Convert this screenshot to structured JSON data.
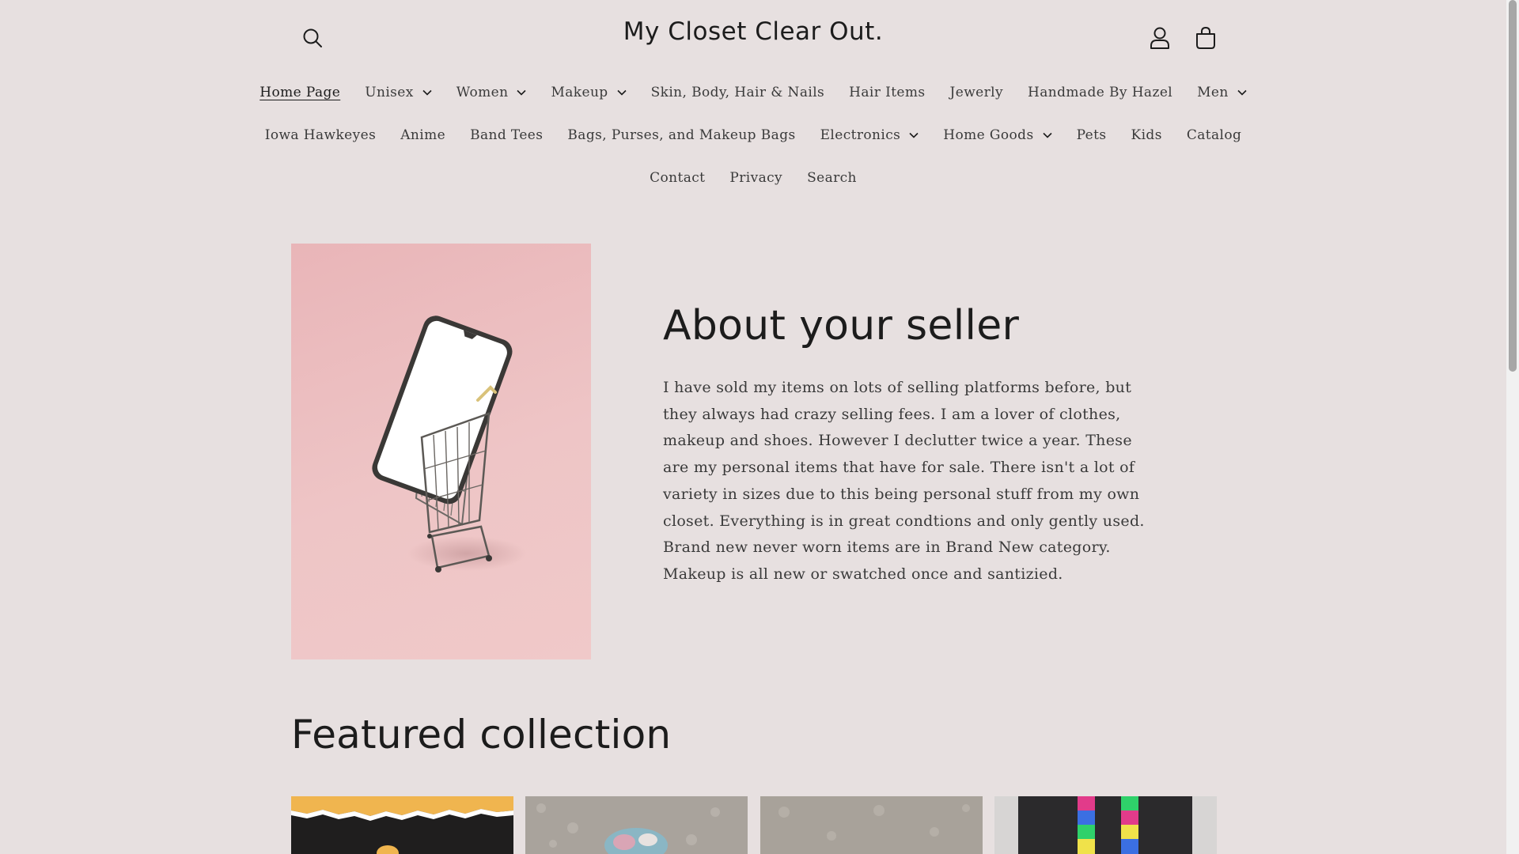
{
  "header": {
    "logo": "My Closet Clear Out.",
    "search_icon": "search-icon",
    "account_icon": "user-icon",
    "cart_icon": "cart-icon"
  },
  "nav": {
    "row1": [
      {
        "label": "Home Page",
        "active": true,
        "dropdown": false
      },
      {
        "label": "Unisex",
        "dropdown": true
      },
      {
        "label": "Women",
        "dropdown": true
      },
      {
        "label": "Makeup",
        "dropdown": true
      },
      {
        "label": "Skin, Body, Hair & Nails",
        "dropdown": false
      },
      {
        "label": "Hair Items",
        "dropdown": false
      },
      {
        "label": "Jewerly",
        "dropdown": false
      },
      {
        "label": "Handmade By Hazel",
        "dropdown": false
      },
      {
        "label": "Men",
        "dropdown": true
      }
    ],
    "row2": [
      {
        "label": "Iowa Hawkeyes",
        "dropdown": false
      },
      {
        "label": "Anime",
        "dropdown": false
      },
      {
        "label": "Band Tees",
        "dropdown": false
      },
      {
        "label": "Bags, Purses, and Makeup Bags",
        "dropdown": false
      },
      {
        "label": "Electronics",
        "dropdown": true
      },
      {
        "label": "Home Goods",
        "dropdown": true
      },
      {
        "label": "Pets",
        "dropdown": false
      },
      {
        "label": "Kids",
        "dropdown": false
      },
      {
        "label": "Catalog",
        "dropdown": false
      }
    ],
    "row3": [
      {
        "label": "Contact",
        "dropdown": false
      },
      {
        "label": "Privacy",
        "dropdown": false
      },
      {
        "label": "Search",
        "dropdown": false
      }
    ]
  },
  "about": {
    "title": "About your seller",
    "body": "I have sold my items on lots of selling platforms before, but they always had crazy selling fees. I am a lover of clothes, makeup and shoes. However I declutter twice a year. These are my personal items that have for sale. There isn't a lot of variety in sizes due to this being personal stuff from my own closet. Everything is in great condtions and only gently used. Brand new never worn items are in Brand New category. Makeup is all new or swatched once and santizied."
  },
  "featured": {
    "title": "Featured collection"
  },
  "colors": {
    "background": "#e7e0e0",
    "text": "#1c1c1c",
    "image_pink": "#eec5c6"
  }
}
